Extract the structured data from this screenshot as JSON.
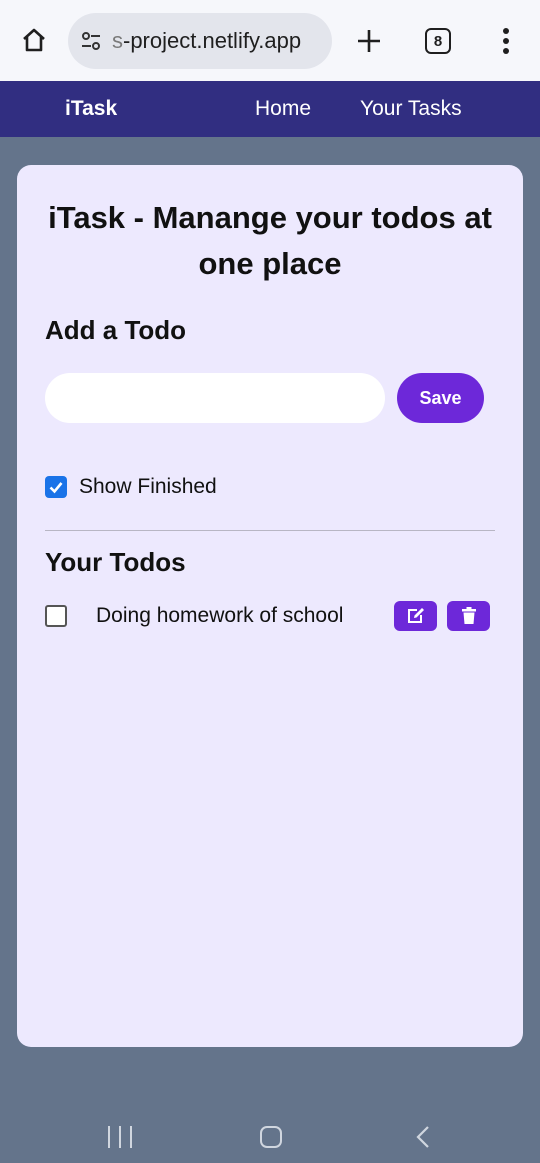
{
  "browser": {
    "url_prefix": "s",
    "url_main": "-project.netlify.app",
    "tab_count": "8",
    "icons": [
      "home-icon",
      "site-settings-icon",
      "new-tab-icon",
      "tab-switcher-icon",
      "more-menu-icon"
    ]
  },
  "navbar": {
    "brand": "iTask",
    "links": [
      "Home",
      "Your Tasks"
    ]
  },
  "main": {
    "title": "iTask - Manange your todos at one place",
    "add_heading": "Add a Todo",
    "input_value": "",
    "save_label": "Save",
    "show_finished_label": "Show Finished",
    "show_finished_checked": true,
    "todos_heading": "Your Todos",
    "todos": [
      {
        "text": "Doing homework of school",
        "completed": false
      }
    ]
  },
  "colors": {
    "navbar": "#312e81",
    "card": "#ede9fe",
    "accent": "#6d28d9",
    "page_bg": "#64748b",
    "checkbox": "#1a73e8"
  }
}
